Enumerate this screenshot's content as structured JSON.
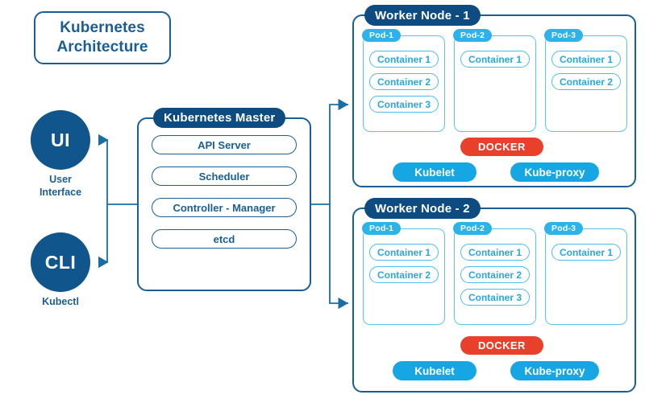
{
  "diagram": {
    "title": "Kubernetes Architecture",
    "title_line_1": "Kubernetes",
    "title_line_2": "Architecture"
  },
  "colors": {
    "navy": "#1b5e96",
    "navy_dark": "#0d4b80",
    "circle_fill": "#10558c",
    "cyan": "#2cb3ea",
    "cyan_light": "#5cc3ef",
    "service_blue": "#16a6e3",
    "docker_red": "#e8402a",
    "background": "#ffffff"
  },
  "clients": [
    {
      "id": "ui",
      "abbr": "UI",
      "caption_line_1": "User",
      "caption_line_2": "Interface"
    },
    {
      "id": "cli",
      "abbr": "CLI",
      "caption_line_1": "Kubectl",
      "caption_line_2": ""
    }
  ],
  "master": {
    "header": "Kubernetes Master",
    "components": [
      {
        "label": "API Server"
      },
      {
        "label": "Scheduler"
      },
      {
        "label": "Controller - Manager"
      },
      {
        "label": "etcd"
      }
    ]
  },
  "workers": [
    {
      "header": "Worker Node - 1",
      "pods": [
        {
          "label": "Pod-1",
          "containers": [
            "Container 1",
            "Container 2",
            "Container 3"
          ]
        },
        {
          "label": "Pod-2",
          "containers": [
            "Container 1"
          ]
        },
        {
          "label": "Pod-3",
          "containers": [
            "Container 1",
            "Container 2"
          ]
        }
      ],
      "runtime": "DOCKER",
      "services": [
        "Kubelet",
        "Kube-proxy"
      ]
    },
    {
      "header": "Worker Node - 2",
      "pods": [
        {
          "label": "Pod-1",
          "containers": [
            "Container 1",
            "Container 2"
          ]
        },
        {
          "label": "Pod-2",
          "containers": [
            "Container 1",
            "Container 2",
            "Container 3"
          ]
        },
        {
          "label": "Pod-3",
          "containers": [
            "Container 1"
          ]
        }
      ],
      "runtime": "DOCKER",
      "services": [
        "Kubelet",
        "Kube-proxy"
      ]
    }
  ]
}
